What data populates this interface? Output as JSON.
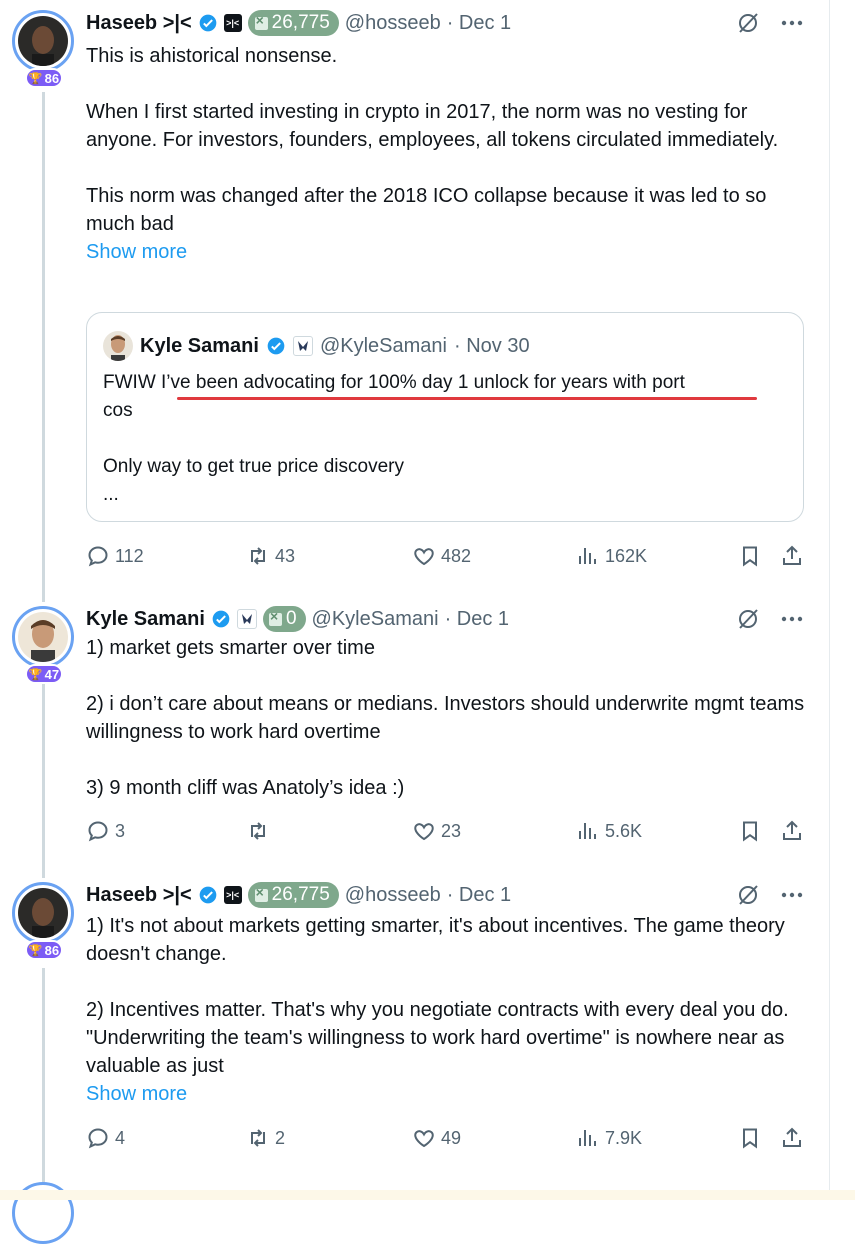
{
  "tweets": [
    {
      "author": {
        "name": "Haseeb >|<",
        "handle": "@hosseeb",
        "date": "· Dec 1",
        "rank": "86",
        "token_count": "26,775",
        "affiliate_text": ">|<"
      },
      "paragraphs": [
        "This is ahistorical nonsense.",
        "When I first started investing in crypto in 2017, the norm was no vesting for anyone. For investors, founders, employees, all tokens circulated immediately.",
        "This norm was changed after the 2018 ICO collapse because it was led to so much bad"
      ],
      "show_more": "Show more",
      "quote": {
        "name": "Kyle Samani",
        "handle": "@KyleSamani",
        "date": "· Nov 30",
        "line1": "FWIW I’ve been advocating for 100% day 1 unlock for years with port",
        "line2": "cos",
        "line3": "Only way to get true price discovery",
        "line4": "..."
      },
      "stats": {
        "replies": "112",
        "reposts": "43",
        "likes": "482",
        "views": "162K"
      }
    },
    {
      "author": {
        "name": "Kyle Samani",
        "handle": "@KyleSamani",
        "date": "· Dec 1",
        "rank": "47",
        "token_count": "0"
      },
      "paragraphs": [
        "1) market gets smarter over time",
        "2) i don’t care about means or medians. Investors should underwrite mgmt teams willingness to work hard overtime",
        "3) 9 month cliff was Anatoly’s idea :)"
      ],
      "stats": {
        "replies": "3",
        "reposts": "",
        "likes": "23",
        "views": "5.6K"
      }
    },
    {
      "author": {
        "name": "Haseeb >|<",
        "handle": "@hosseeb",
        "date": "· Dec 1",
        "rank": "86",
        "token_count": "26,775",
        "affiliate_text": ">|<"
      },
      "paragraphs": [
        "1) It's not about markets getting smarter, it's about incentives. The game theory doesn't change.",
        "2) Incentives matter. That's why you negotiate contracts  with every deal you do. \"Underwriting the team's willingness to work hard overtime\" is nowhere near as valuable as just"
      ],
      "show_more": "Show more",
      "stats": {
        "replies": "4",
        "reposts": "2",
        "likes": "49",
        "views": "7.9K"
      }
    }
  ],
  "colors": {
    "link": "#1d9bf0",
    "verified": "#1d9bf0",
    "underline": "#e0393e",
    "muted": "#536471",
    "rank_badge": "#7c5cf5",
    "token_pill": "#7fa88c"
  },
  "icons": [
    "reply-icon",
    "repost-icon",
    "like-icon",
    "views-icon",
    "bookmark-icon",
    "share-icon",
    "grok-icon",
    "more-icon",
    "verified-icon",
    "trophy-icon"
  ]
}
